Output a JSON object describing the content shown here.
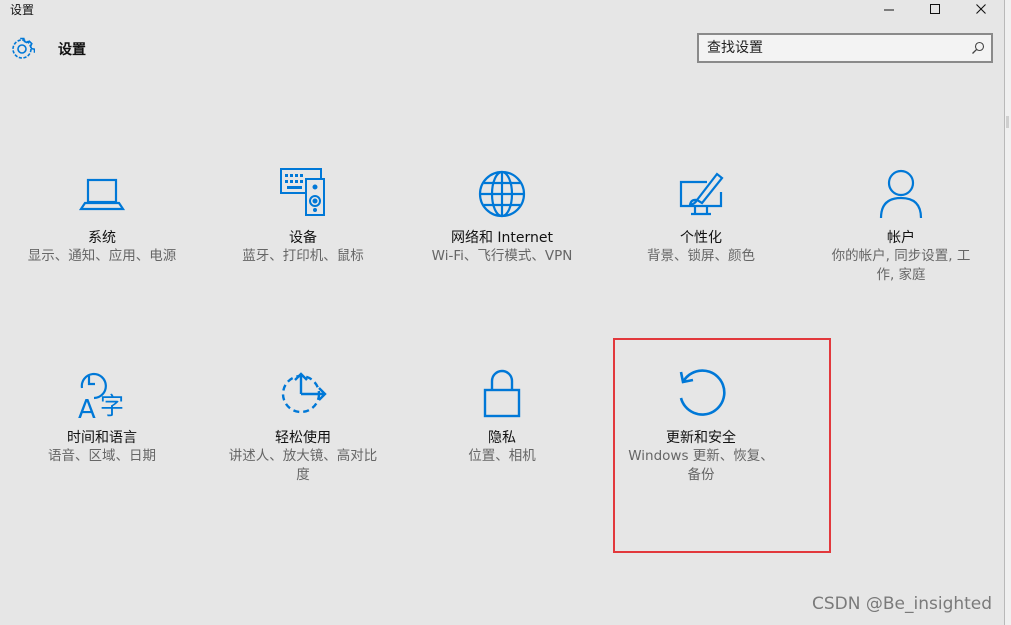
{
  "window": {
    "title": "设置",
    "controls": [
      "minimize",
      "maximize",
      "close"
    ]
  },
  "header": {
    "title": "设置",
    "icon": "gear-icon"
  },
  "search": {
    "placeholder": "查找设置",
    "icon": "search-icon"
  },
  "tiles": [
    {
      "name": "系统",
      "desc": "显示、通知、应用、电源",
      "icon": "laptop-icon"
    },
    {
      "name": "设备",
      "desc": "蓝牙、打印机、鼠标",
      "icon": "keyboard-speaker-icon"
    },
    {
      "name": "网络和 Internet",
      "desc": "Wi-Fi、飞行模式、VPN",
      "icon": "globe-icon"
    },
    {
      "name": "个性化",
      "desc": "背景、锁屏、颜色",
      "icon": "paint-brush-icon"
    },
    {
      "name": "帐户",
      "desc": "你的帐户, 同步设置, 工作, 家庭",
      "icon": "person-icon"
    },
    {
      "name": "时间和语言",
      "desc": "语音、区域、日期",
      "icon": "time-language-icon"
    },
    {
      "name": "轻松使用",
      "desc": "讲述人、放大镜、高对比度",
      "icon": "ease-of-access-icon"
    },
    {
      "name": "隐私",
      "desc": "位置、相机",
      "icon": "lock-icon"
    },
    {
      "name": "更新和安全",
      "desc": "Windows 更新、恢复、备份",
      "icon": "refresh-icon"
    }
  ],
  "accent_color": "#0078d7",
  "highlight_color": "#e2383c",
  "watermark": "CSDN @Be_insighted"
}
